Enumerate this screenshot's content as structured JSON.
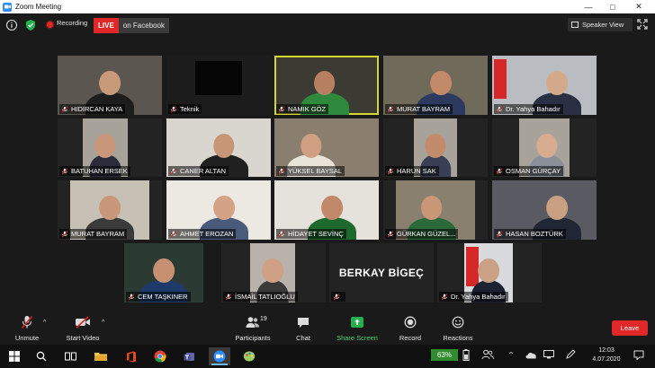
{
  "window": {
    "title": "Zoom Meeting"
  },
  "topbar": {
    "recording_label": "Recording",
    "live_label": "LIVE",
    "live_target": "on Facebook",
    "view_label": "Speaker View"
  },
  "participants": [
    {
      "name": "HIDIRCAN KAYA"
    },
    {
      "name": "Teknik"
    },
    {
      "name": "NAMIK GÖZ"
    },
    {
      "name": "MURAT BAYRAM"
    },
    {
      "name": "Dr. Yahya Bahadır"
    },
    {
      "name": "BATUHAN ERSEK"
    },
    {
      "name": "CANER ALTAN"
    },
    {
      "name": "YÜKSEL BAYSAL"
    },
    {
      "name": "HARUN SAK"
    },
    {
      "name": "OSMAN GÜRÇAY"
    },
    {
      "name": "MURAT BAYRAM"
    },
    {
      "name": "AHMET EROZAN"
    },
    {
      "name": "HİDAYET SEVİNÇ"
    },
    {
      "name": "GÜRKAN GÜZEL..."
    },
    {
      "name": "HASAN BOZTÜRK"
    },
    {
      "name": "CEM TAŞKINER"
    },
    {
      "name": "İSMAİL TATLIOĞLU"
    },
    {
      "name": ""
    },
    {
      "name": "Dr. Yahya Bahadır"
    }
  ],
  "video_off_name": "BERKAY BİGEÇ",
  "toolbar": {
    "unmute": "Unmute",
    "start_video": "Start Video",
    "participants": "Participants",
    "participants_count": "19",
    "chat": "Chat",
    "share_screen": "Share Screen",
    "record": "Record",
    "reactions": "Reactions",
    "leave": "Leave"
  },
  "taskbar": {
    "battery": "63%",
    "time": "12:03",
    "date": "4.07.2020"
  },
  "colors": {
    "zoom_blue": "#2d8cff",
    "live_red": "#e02828",
    "active_speaker": "#d6d632",
    "share_green": "#22b14c",
    "battery_green": "#2e8b2e"
  }
}
